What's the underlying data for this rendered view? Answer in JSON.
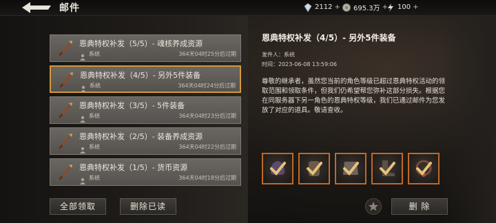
{
  "header": {
    "title": "邮件",
    "currencies": [
      {
        "icon": "diamond-icon",
        "value": "2112",
        "plus": "+"
      },
      {
        "icon": "coin-icon",
        "value": "695.3万",
        "plus": "+"
      },
      {
        "icon": "lightning-icon",
        "value": "100",
        "plus": "+"
      }
    ]
  },
  "mails": [
    {
      "title": "恩典特权补发（5/5）- 魂核养成资源",
      "sender": "系统",
      "expire": "364天04时25分后过期",
      "selected": false
    },
    {
      "title": "恩典特权补发（4/5）- 另外5件装备",
      "sender": "系统",
      "expire": "364天04时24分后过期",
      "selected": true
    },
    {
      "title": "恩典特权补发（3/5）- 5件装备",
      "sender": "系统",
      "expire": "364天04时23分后过期",
      "selected": false
    },
    {
      "title": "恩典特权补发（2/5）- 装备养成资源",
      "sender": "系统",
      "expire": "364天04时22分后过期",
      "selected": false
    },
    {
      "title": "恩典特权补发（1/5）- 货币资源",
      "sender": "系统",
      "expire": "364天04时18分后过期",
      "selected": false
    }
  ],
  "detail": {
    "title": "恩典特权补发（4/5）- 另外5件装备",
    "sender_line": "发件人：系统",
    "time_line": "时间：2023-06-08 13:59:06",
    "body": "尊敬的继承者，虽然您当前的角色等级已超过恩典特权活动的领取范围和领取条件，但我们仍希望帮您弥补这部分损失。根据您在同服务器下另一角色的恩典特权等级，我们已通过邮件为您发放了对应的道具。敬请查收。"
  },
  "rewards": [
    {
      "icon": "equipment-helmet-icon",
      "claimed": true
    },
    {
      "icon": "equipment-gauntlet-icon",
      "claimed": true
    },
    {
      "icon": "equipment-armor-icon",
      "claimed": true
    },
    {
      "icon": "equipment-boots-icon",
      "claimed": true
    },
    {
      "icon": "equipment-necklace-icon",
      "claimed": true
    }
  ],
  "buttons": {
    "claim_all": "全部领取",
    "delete_read": "删除已读",
    "delete": "删 除"
  },
  "colors": {
    "accent": "#d39a3a",
    "reward_border": "#c06a2a",
    "check": "#e8c27a"
  }
}
